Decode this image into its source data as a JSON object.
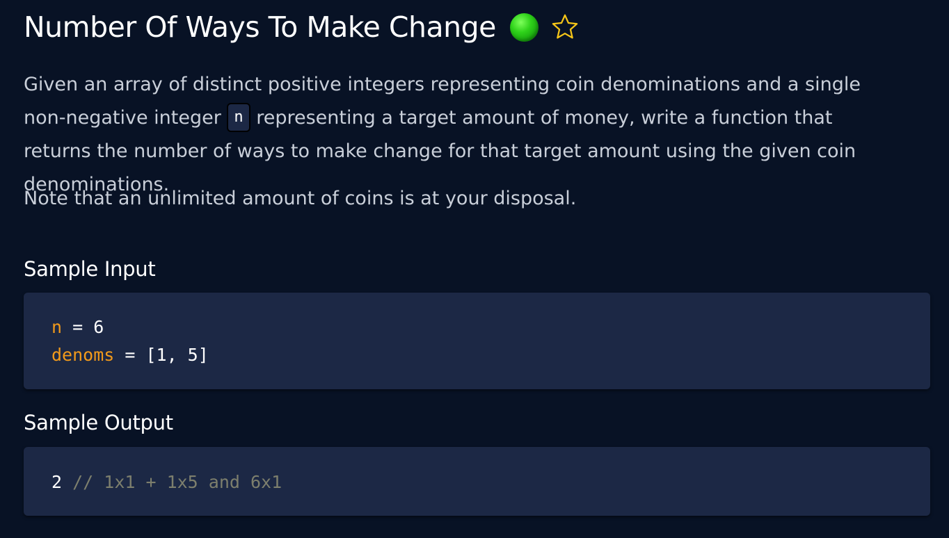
{
  "problem": {
    "title": "Number Of Ways To Make Change",
    "difficulty_color": "#2fd21a",
    "favorite_icon": "star-outline-icon",
    "description_before_code": "Given an array of distinct positive integers representing coin denominations and a single non-negative integer ",
    "description_inline_code": "n",
    "description_after_code": " representing a target amount of money, write a function that returns the number of ways to make change for that target amount using the given coin denominations.",
    "note": "Note that an unlimited amount of coins is at your disposal."
  },
  "sample_input": {
    "heading": "Sample Input",
    "lines": [
      {
        "var": "n",
        "op": " = ",
        "value": "6"
      },
      {
        "var": "denoms",
        "op": " = ",
        "value": "[1, 5]"
      }
    ]
  },
  "sample_output": {
    "heading": "Sample Output",
    "value": "2",
    "comment": " // 1x1 + 1x5 and 6x1"
  },
  "colors": {
    "background": "#081225",
    "code_background": "#1c2845",
    "variable": "#f29a1b",
    "comment": "#7d7f6d",
    "star": "#f5c518"
  }
}
